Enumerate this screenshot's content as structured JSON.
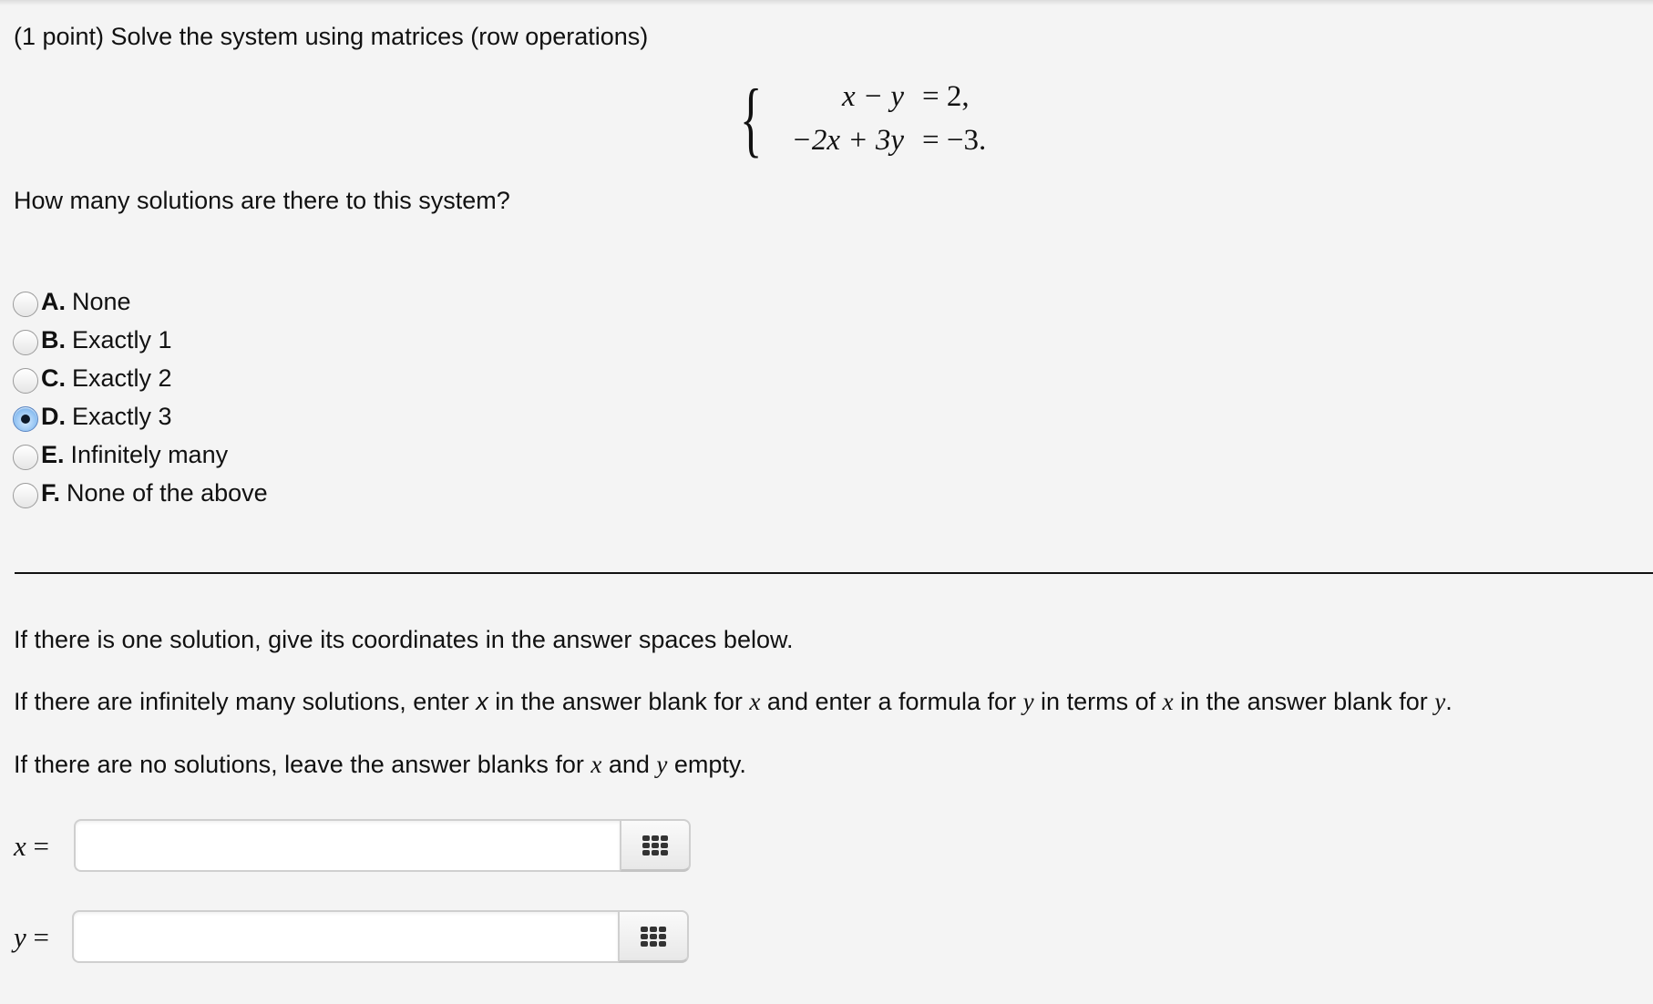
{
  "problem": {
    "title": "(1 point) Solve the system using matrices (row operations)",
    "system": {
      "rows": [
        {
          "lhs": "x − y",
          "rhs": "= 2,"
        },
        {
          "lhs": "−2x + 3y",
          "rhs": "= −3."
        }
      ]
    },
    "question": "How many solutions are there to this system?"
  },
  "options": [
    {
      "letter": "A.",
      "label": "None",
      "checked": false
    },
    {
      "letter": "B.",
      "label": "Exactly 1",
      "checked": false
    },
    {
      "letter": "C.",
      "label": "Exactly 2",
      "checked": false
    },
    {
      "letter": "D.",
      "label": "Exactly 3",
      "checked": true
    },
    {
      "letter": "E.",
      "label": "Infinitely many",
      "checked": false
    },
    {
      "letter": "F.",
      "label": "None of the above",
      "checked": false
    }
  ],
  "instructions": {
    "p1": "If there is one solution, give its coordinates in the answer spaces below.",
    "p2": {
      "a": "If there are infinitely many solutions, enter ",
      "v1": "x",
      "b": " in the answer blank for ",
      "v2": "x",
      "c": " and enter a formula for ",
      "v3": "y",
      "d": " in terms of ",
      "v4": "x",
      "e": " in the answer blank for ",
      "v5": "y",
      "f": "."
    },
    "p3": {
      "a": "If there are no solutions, leave the answer blanks for ",
      "v1": "x",
      "b": " and ",
      "v2": "y",
      "c": " empty."
    }
  },
  "answers": {
    "x": {
      "label_var": "x",
      "label_eq": " =",
      "value": "",
      "button_icon": "equation-editor-grid-icon"
    },
    "y": {
      "label_var": "y",
      "label_eq": " =",
      "value": "",
      "button_icon": "equation-editor-grid-icon"
    }
  }
}
